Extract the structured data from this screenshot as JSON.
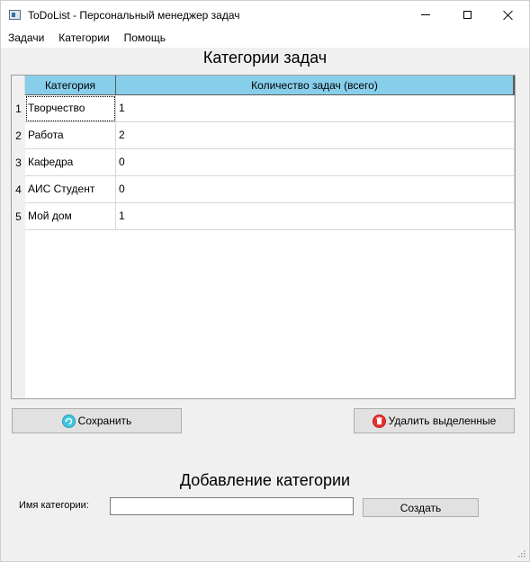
{
  "window": {
    "title": "ToDoList - Персональный менеджер задач"
  },
  "menu": {
    "items": [
      "Задачи",
      "Категории",
      "Помощь"
    ]
  },
  "categories_section": {
    "title": "Категории задач",
    "table": {
      "headers": [
        "Категория",
        "Количество задач (всего)"
      ],
      "header_color": "#87ceeb",
      "rows": [
        {
          "num": "1",
          "name": "Творчество",
          "count": "1"
        },
        {
          "num": "2",
          "name": "Работа",
          "count": "2"
        },
        {
          "num": "3",
          "name": "Кафедра",
          "count": "0"
        },
        {
          "num": "4",
          "name": "АИС Студент",
          "count": "0"
        },
        {
          "num": "5",
          "name": "Мой дом",
          "count": "1"
        }
      ]
    },
    "save_button": {
      "label": "Сохранить",
      "icon": "save-icon"
    },
    "delete_button": {
      "label": "Удалить выделенные",
      "icon": "trash-icon"
    }
  },
  "add_section": {
    "title": "Добавление категории",
    "name_label": "Имя категории:",
    "name_value": "",
    "create_button": "Создать"
  }
}
